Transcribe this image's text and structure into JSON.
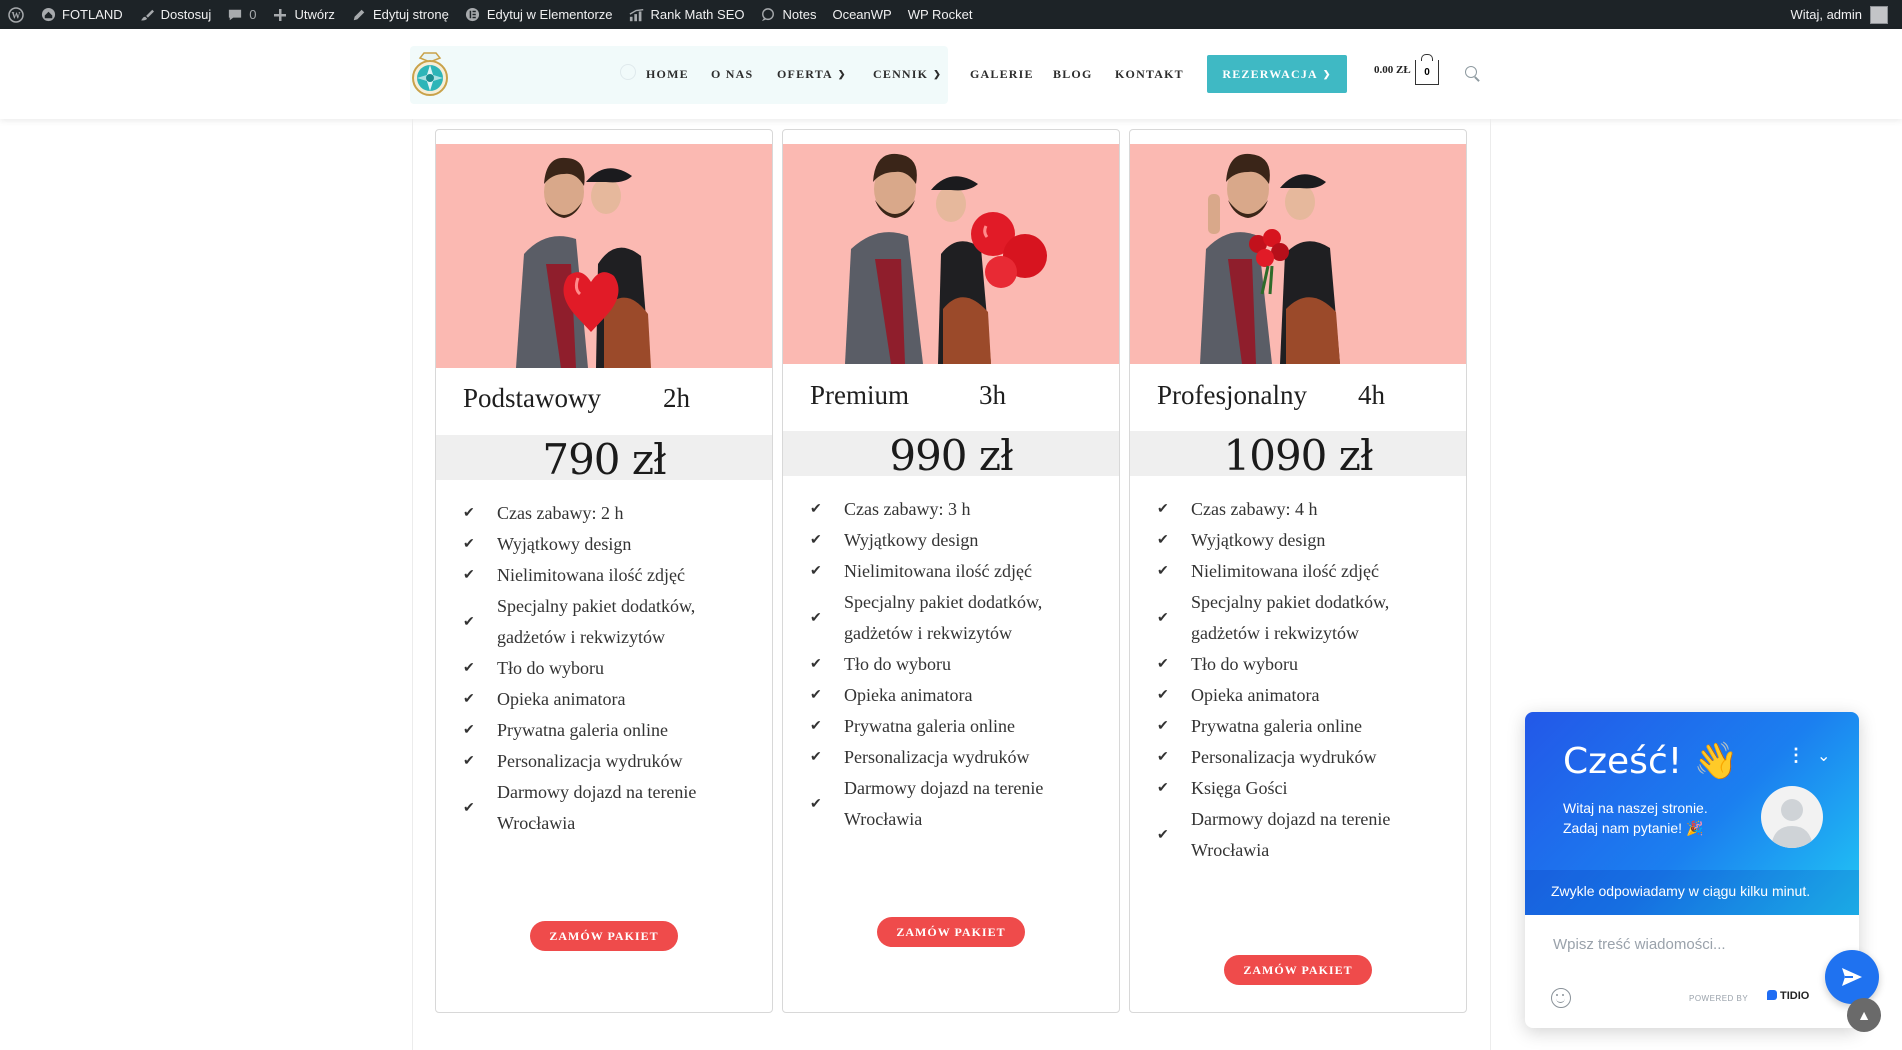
{
  "admin_bar": {
    "items": [
      {
        "icon": "wordpress-icon",
        "label": ""
      },
      {
        "icon": "home-icon",
        "label": "FOTLAND"
      },
      {
        "icon": "brush-icon",
        "label": "Dostosuj"
      },
      {
        "icon": "comment-icon",
        "label": "0"
      },
      {
        "icon": "plus-icon",
        "label": "Utwórz"
      },
      {
        "icon": "pencil-icon",
        "label": "Edytuj stronę"
      },
      {
        "icon": "elementor-icon",
        "label": "Edytuj w Elementorze"
      },
      {
        "icon": "rank-math-icon",
        "label": "Rank Math SEO"
      },
      {
        "icon": "notes-icon",
        "label": "Notes"
      },
      {
        "icon": "",
        "label": "OceanWP"
      },
      {
        "icon": "",
        "label": "WP Rocket"
      }
    ],
    "greeting": "Witaj, admin"
  },
  "header": {
    "nav": [
      {
        "label": "HOME",
        "dropdown": false
      },
      {
        "label": "O NAS",
        "dropdown": false
      },
      {
        "label": "OFERTA",
        "dropdown": true
      },
      {
        "label": "CENNIK",
        "dropdown": true
      },
      {
        "label": "GALERIE",
        "dropdown": false
      },
      {
        "label": "BLOG",
        "dropdown": false
      },
      {
        "label": "KONTAKT",
        "dropdown": false
      }
    ],
    "cta": "REZERWACJA",
    "cart_total": "0.00 ZŁ",
    "cart_count": "0",
    "accent_color": "#3fb9c4"
  },
  "pricing": [
    {
      "title": "Podstawowy",
      "duration": "2h",
      "price": "790 zł",
      "features": [
        "Czas zabawy: 2 h",
        "Wyjątkowy design",
        "Nielimitowana ilość zdjęć",
        "Specjalny pakiet dodatków, gadżetów i rekwizytów",
        "Tło do wyboru",
        "Opieka animatora",
        "Prywatna galeria online",
        "Personalizacja wydruków",
        "Darmowy dojazd na terenie Wrocławia"
      ],
      "button": "ZAMÓW PAKIET"
    },
    {
      "title": "Premium",
      "duration": "3h",
      "price": "990 zł",
      "features": [
        "Czas zabawy: 3 h",
        "Wyjątkowy design",
        "Nielimitowana ilość zdjęć",
        "Specjalny pakiet dodatków, gadżetów i rekwizytów",
        "Tło do wyboru",
        "Opieka animatora",
        "Prywatna galeria online",
        "Personalizacja wydruków",
        "Darmowy dojazd na terenie Wrocławia"
      ],
      "button": "ZAMÓW PAKIET"
    },
    {
      "title": "Profesjonalny",
      "duration": "4h",
      "price": "1090 zł",
      "features": [
        "Czas zabawy: 4 h",
        "Wyjątkowy design",
        "Nielimitowana ilość zdjęć",
        "Specjalny pakiet dodatków, gadżetów i rekwizytów",
        "Tło do wyboru",
        "Opieka animatora",
        "Prywatna galeria online",
        "Personalizacja wydruków",
        "Księga Gości",
        "Darmowy dojazd na terenie Wrocławia"
      ],
      "button": "ZAMÓW PAKIET"
    }
  ],
  "chat": {
    "greeting": "Cześć! 👋",
    "subtitle": "Witaj na naszej stronie. Zadaj nam pytanie! 🎉",
    "response_time": "Zwykle odpowiadamy w ciągu kilku minut.",
    "input_placeholder": "Wpisz treść wiadomości...",
    "powered_by": "POWERED BY",
    "brand": "TIDIO"
  },
  "colors": {
    "button_red": "#ef4b4b",
    "photo_background": "#fbb9b2",
    "chat_gradient_start": "#2358e8",
    "chat_gradient_end": "#21c8f4"
  }
}
